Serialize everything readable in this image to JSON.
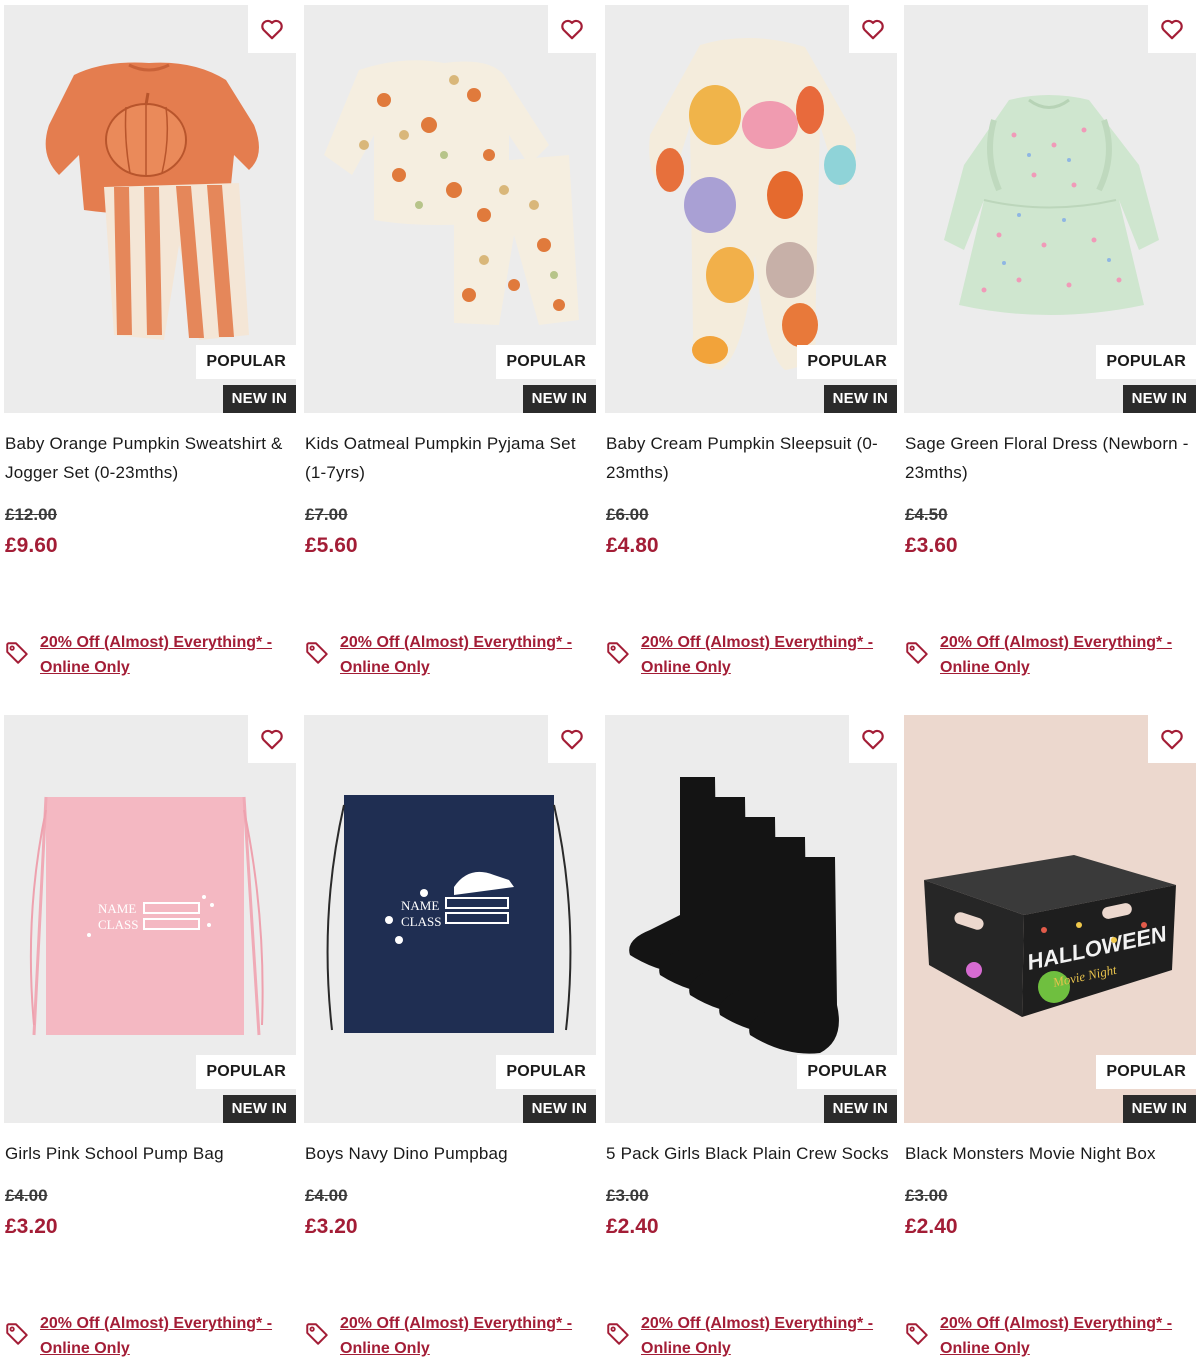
{
  "badges": {
    "popular": "POPULAR",
    "new_in": "NEW IN"
  },
  "promo_text": "20% Off (Almost) Everything* - Online Only",
  "accent_color": "#a31d36",
  "products": [
    {
      "title": "Baby Orange Pumpkin Sweatshirt & Jogger Set (0-23mths)",
      "was": "£12.00",
      "now": "£9.60",
      "image": "orange-pumpkin-sweatshirt-jogger-set"
    },
    {
      "title": "Kids Oatmeal Pumpkin Pyjama Set (1-7yrs)",
      "was": "£7.00",
      "now": "£5.60",
      "image": "oatmeal-pumpkin-pyjama-set"
    },
    {
      "title": "Baby Cream Pumpkin Sleepsuit (0-23mths)",
      "was": "£6.00",
      "now": "£4.80",
      "image": "cream-pumpkin-sleepsuit"
    },
    {
      "title": "Sage Green Floral Dress (Newborn - 23mths)",
      "was": "£4.50",
      "now": "£3.60",
      "image": "sage-green-floral-dress"
    },
    {
      "title": "Girls Pink School Pump Bag",
      "was": "£4.00",
      "now": "£3.20",
      "image": "pink-pump-bag",
      "bag_text": [
        "NAME",
        "CLASS"
      ]
    },
    {
      "title": "Boys Navy Dino Pumpbag",
      "was": "£4.00",
      "now": "£3.20",
      "image": "navy-dino-pump-bag",
      "bag_text": [
        "NAME",
        "CLASS"
      ]
    },
    {
      "title": "5 Pack Girls Black Plain Crew Socks",
      "was": "£3.00",
      "now": "£2.40",
      "image": "black-crew-socks"
    },
    {
      "title": "Black Monsters Movie Night Box",
      "was": "£3.00",
      "now": "£2.40",
      "image": "halloween-movie-night-box",
      "box_text": [
        "HALLOWEEN",
        "Movie Night"
      ]
    }
  ]
}
